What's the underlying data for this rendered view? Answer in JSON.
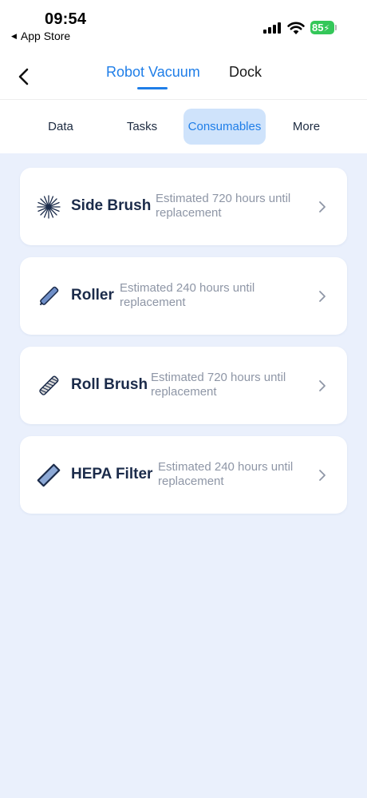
{
  "status": {
    "time": "09:54",
    "back_app": "App Store",
    "battery": "85"
  },
  "header": {
    "tabs": [
      "Robot Vacuum",
      "Dock"
    ],
    "active_tab": "Robot Vacuum"
  },
  "subtabs": {
    "items": [
      "Data",
      "Tasks",
      "Consumables",
      "More"
    ],
    "active": "Consumables"
  },
  "consumables": [
    {
      "name": "Side Brush",
      "description": "Estimated 720 hours until replacement",
      "icon": "side-brush-icon"
    },
    {
      "name": "Roller",
      "description": "Estimated 240 hours until replacement",
      "icon": "roller-icon"
    },
    {
      "name": "Roll Brush",
      "description": "Estimated 720 hours until replacement",
      "icon": "roll-brush-icon"
    },
    {
      "name": "HEPA Filter",
      "description": "Estimated 240 hours until replacement",
      "icon": "hepa-filter-icon"
    }
  ],
  "colors": {
    "accent": "#1f7ee8",
    "background": "#eaf0fc",
    "active_subtab_bg": "#cfe3fb",
    "battery": "#34c759"
  }
}
